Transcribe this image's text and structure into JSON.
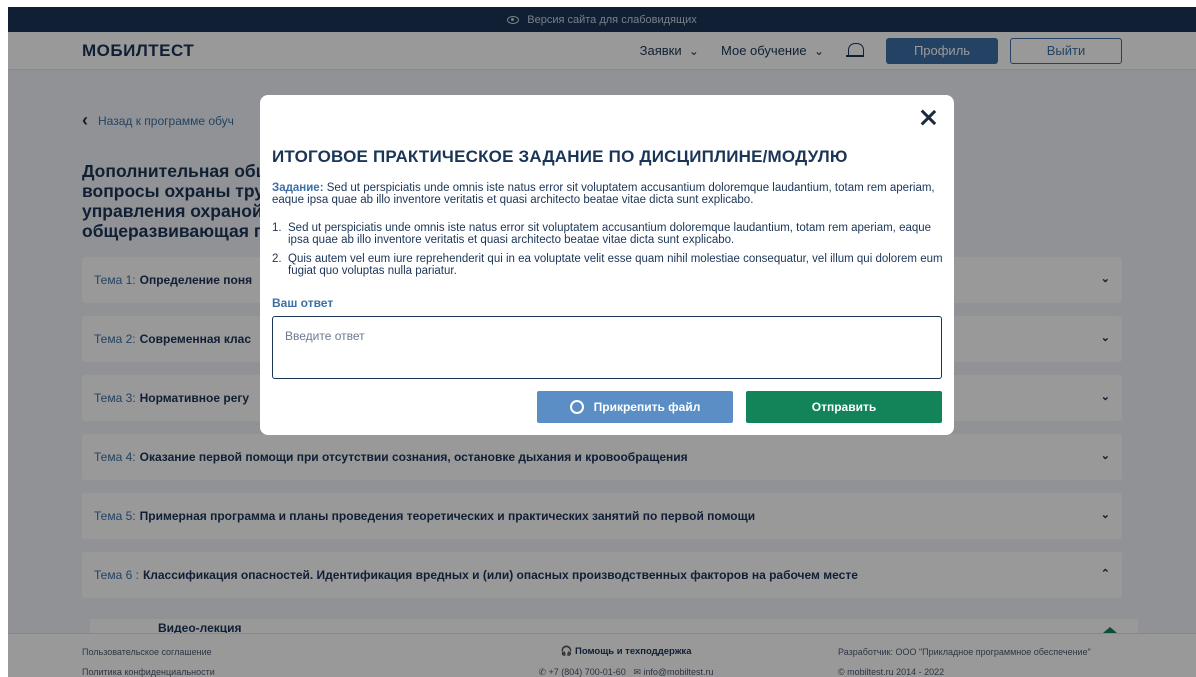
{
  "topbar": {
    "accessibility_label": "Версия сайта для слабовидящих"
  },
  "header": {
    "logo": "МОБИЛТЕСТ",
    "nav": [
      "Заявки",
      "Мое обучение"
    ],
    "profile_label": "Профиль",
    "exit_label": "Выйти"
  },
  "main": {
    "back_label": "Назад к программе обуч",
    "program_title_lines": [
      "Дополнительная обще",
      "вопросы охраны тру",
      "управления охраной",
      "общеразвивающая п"
    ],
    "topics": [
      {
        "num": "Тема 1:",
        "name": "Определение поня"
      },
      {
        "num": "Тема 2:",
        "name": "Современная клас"
      },
      {
        "num": "Тема 3:",
        "name": "Нормативное регу"
      },
      {
        "num": "Тема 4:",
        "name": "Оказание первой помощи при отсутствии сознания, остановке дыхания и кровообращения"
      },
      {
        "num": "Тема 5:",
        "name": "Примерная программа и планы проведения теоретических и практических занятий по первой помощи"
      },
      {
        "num": "Тема 6 :",
        "name": "Классификация опасностей. Идентификация вредных и (или) опасных производственных факторов на рабочем месте"
      }
    ],
    "lecture_title": "Видео-лекция"
  },
  "footer": {
    "user_agreement": "Пользовательское соглашение",
    "privacy_policy": "Политика конфиденциальности",
    "support_title": "Помощь и техподдержка",
    "phone": "+7 (804) 700-01-60",
    "email": "info@mobiltest.ru",
    "developer": "Разработчик: ООО \"Прикладное программное обеспечение\"",
    "copyright": "© mobiltest.ru 2014 - 2022"
  },
  "modal": {
    "title": "ИТОГОВОЕ ПРАКТИЧЕСКОЕ ЗАДАНИЕ ПО ДИСЦИПЛИНЕ/МОДУЛЮ",
    "task_label": "Задание:",
    "task_text": "Sed ut perspiciatis unde omnis iste natus error sit voluptatem accusantium doloremque laudantium, totam rem aperiam, eaque ipsa quae ab illo inventore veritatis et quasi architecto beatae vitae dicta sunt explicabo.",
    "items": [
      {
        "num": "1.",
        "text": "Sed ut perspiciatis unde omnis iste natus error sit voluptatem accusantium doloremque laudantium, totam rem aperiam, eaque ipsa quae ab illo inventore veritatis et quasi architecto beatae vitae dicta sunt explicabo."
      },
      {
        "num": "2.",
        "text": "Quis autem vel eum iure reprehenderit qui in ea voluptate velit esse quam nihil molestiae consequatur, vel illum qui dolorem eum fugiat quo voluptas nulla pariatur."
      }
    ],
    "answer_label": "Ваш ответ",
    "answer_placeholder": "Введите ответ",
    "attach_label": "Прикрепить файл",
    "send_label": "Отправить"
  },
  "colors": {
    "navy": "#1b3557",
    "accent_blue": "#3d6fa7",
    "attach_blue": "#5b8ec4",
    "send_green": "#13845a"
  },
  "icons": [
    "eye-icon",
    "bell-icon",
    "chevron-left-icon",
    "chevron-down-icon",
    "chevron-up-icon",
    "close-icon",
    "paperclip-icon",
    "headset-icon",
    "phone-icon",
    "mail-icon",
    "video-icon"
  ]
}
